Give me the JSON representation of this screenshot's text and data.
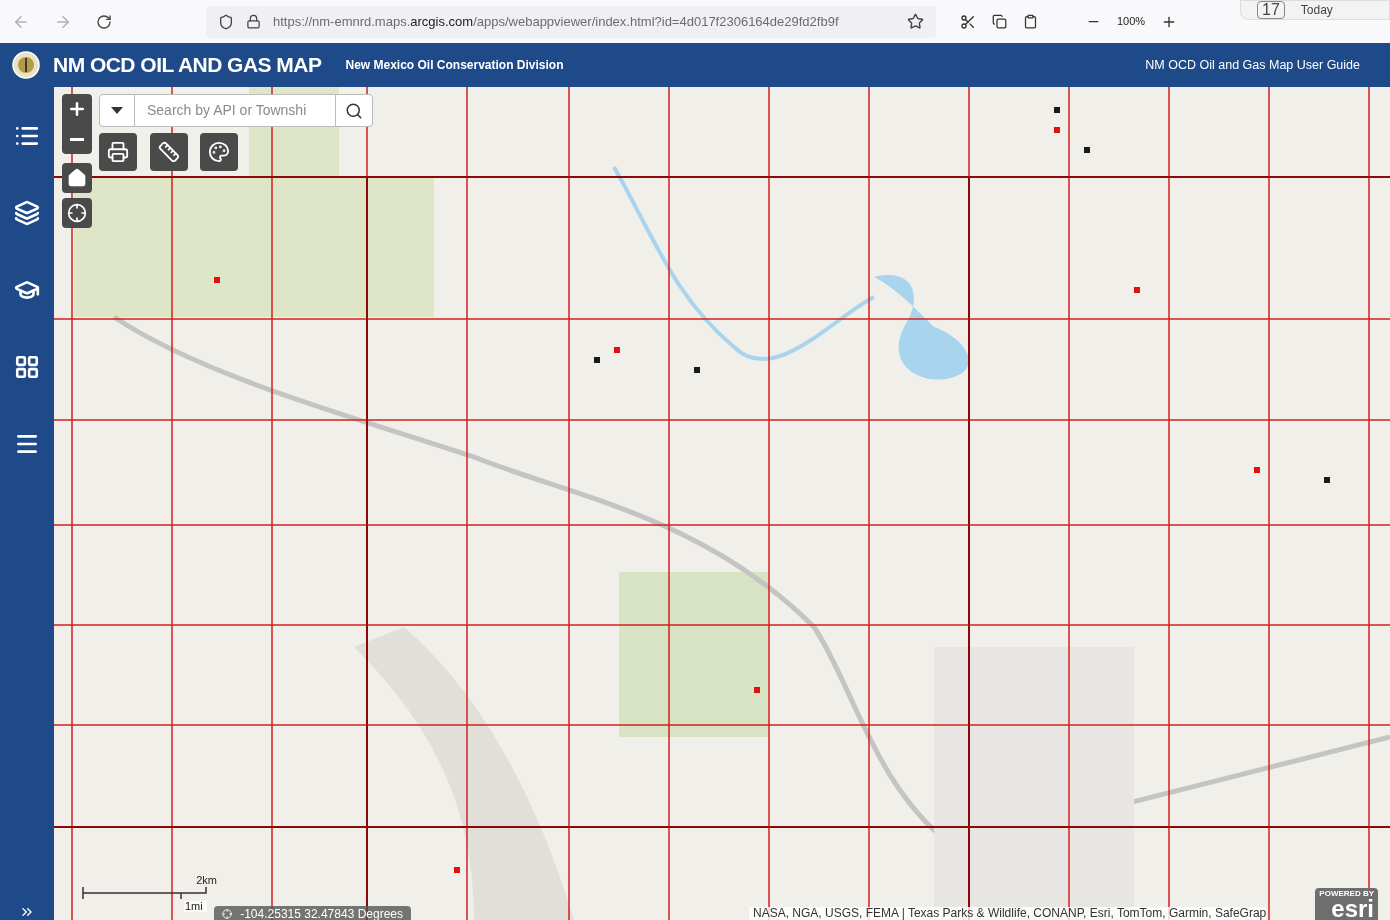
{
  "browser": {
    "url_prefix": "https://nm-emnrd.maps.",
    "url_domain": "arcgis.com",
    "url_rest": "/apps/webappviewer/index.html?id=4d017f2306164de29fd2fb9f",
    "zoom": "100%",
    "calendar": {
      "day": "17",
      "label": "Today"
    }
  },
  "header": {
    "title": "NM OCD OIL AND GAS MAP",
    "subtitle": "New Mexico Oil Conservation Division",
    "link": "NM OCD Oil and Gas Map User Guide"
  },
  "sidebar": {
    "items": [
      {
        "kind": "legend"
      },
      {
        "kind": "layers"
      },
      {
        "kind": "basemap"
      },
      {
        "kind": "widgets"
      },
      {
        "kind": "list"
      }
    ]
  },
  "search": {
    "placeholder": "Search by API or Townshi"
  },
  "scalebar": {
    "metric": "2km",
    "imperial": "1mi"
  },
  "coordinates": "-104.25315 32.47843 Degrees",
  "attribution": "NASA, NGA, USGS, FEMA | Texas Parks & Wildlife, CONANP, Esri, TomTom, Garmin, SafeGrap",
  "esri_logo": {
    "caption": "POWERED BY",
    "name": "esri"
  }
}
